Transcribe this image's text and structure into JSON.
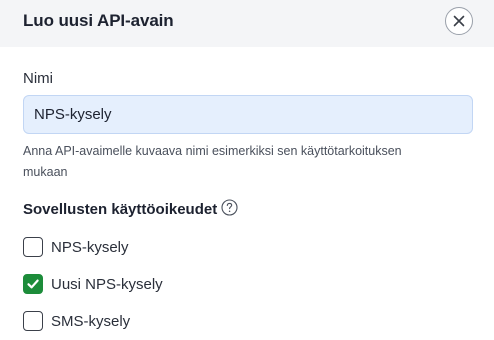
{
  "dialog": {
    "title": "Luo uusi API-avain"
  },
  "name_field": {
    "label": "Nimi",
    "value": "NPS-kysely",
    "hint": "Anna API-avaimelle kuvaava nimi esimerkiksi sen käyttötarkoituksen mukaan"
  },
  "applications": {
    "title": "Sovellusten käyttöoikeudet",
    "help_icon": "question-circle-icon",
    "items": [
      {
        "label": "NPS-kysely",
        "checked": false
      },
      {
        "label": "Uusi NPS-kysely",
        "checked": true
      },
      {
        "label": "SMS-kysely",
        "checked": false
      }
    ]
  },
  "colors": {
    "checked": "#1c8c3a",
    "input_bg": "#e5effd",
    "header_bg": "#f4f5f7"
  }
}
